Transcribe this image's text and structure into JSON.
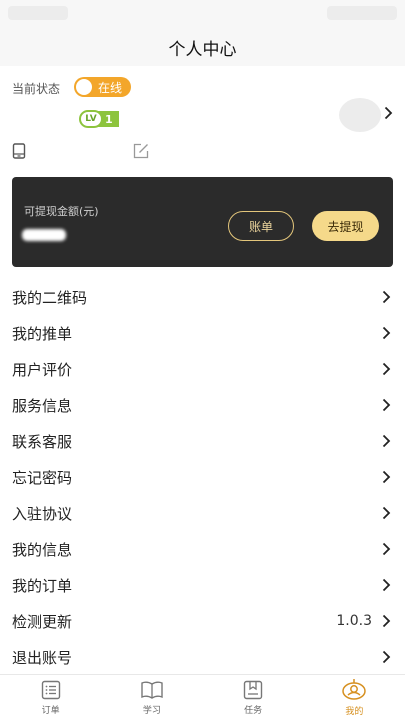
{
  "header": {
    "title": "个人中心"
  },
  "profile": {
    "status_label": "当前状态",
    "online_text": "在线",
    "level_badge": "LV",
    "level_value": "1"
  },
  "wallet": {
    "label": "可提现金额(元)",
    "bill_button": "账单",
    "withdraw_button": "去提现"
  },
  "menu": [
    {
      "label": "我的二维码"
    },
    {
      "label": "我的推单"
    },
    {
      "label": "用户评价"
    },
    {
      "label": "服务信息"
    },
    {
      "label": "联系客服"
    },
    {
      "label": "忘记密码"
    },
    {
      "label": "入驻协议"
    },
    {
      "label": "我的信息"
    },
    {
      "label": "我的订单"
    },
    {
      "label": "检测更新",
      "value": "1.0.3"
    },
    {
      "label": "退出账号"
    }
  ],
  "tabs": [
    {
      "label": "订单",
      "icon": "order-list-icon"
    },
    {
      "label": "学习",
      "icon": "book-icon"
    },
    {
      "label": "任务",
      "icon": "task-icon"
    },
    {
      "label": "我的",
      "icon": "mine-icon",
      "active": true
    }
  ],
  "colors": {
    "accent": "#f3a62a",
    "level_green": "#8dc43d",
    "wallet_bg": "#2b2b2b",
    "withdraw_bg": "#f5d98a",
    "tab_active": "#d69020"
  }
}
